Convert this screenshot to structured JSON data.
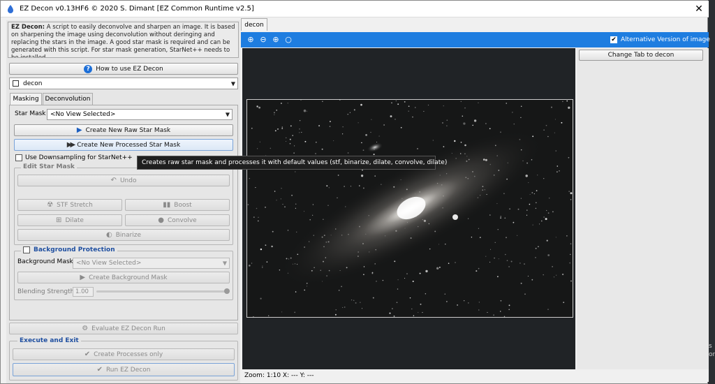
{
  "window": {
    "title": "EZ Decon v0.13HF6 © 2020 S. Dimant [EZ Common Runtime v2.5]",
    "close": "✕"
  },
  "description": {
    "lead": "EZ Decon:",
    "text": " A script to easily deconvolve and sharpen an image. It is based on sharpening the image using deconvolution without deringing and replacing the stars in the image. A good star mask is required and can be generated with this script. For star mask generation, StarNet++ needs to be installed."
  },
  "how_to_button": "How to use EZ Decon",
  "image_select": {
    "value": "decon"
  },
  "tabs": [
    {
      "label": "Masking",
      "active": true
    },
    {
      "label": "Deconvolution",
      "active": false
    }
  ],
  "masking": {
    "star_mask_label": "Star Mask",
    "star_mask_value": "<No View Selected>",
    "create_raw_button": "Create New Raw Star Mask",
    "create_processed_button": "Create New Processed Star Mask",
    "downsampling_label": "Use Downsampling for StarNet++",
    "edit_star_mask": {
      "title": "Edit Star Mask",
      "undo": "Undo",
      "stf_stretch": "STF Stretch",
      "boost": "Boost",
      "dilate": "Dilate",
      "convolve": "Convolve",
      "binarize": "Binarize"
    },
    "background_protection": {
      "title": "Background Protection",
      "mask_label": "Background Mask",
      "mask_value": "<No View Selected>",
      "create_button": "Create Background Mask",
      "blending_label": "Blending Strength",
      "blending_value": "1.00"
    }
  },
  "evaluate_button": "Evaluate EZ Decon Run",
  "execute": {
    "title": "Execute and Exit",
    "create_processes": "Create Processes only",
    "run": "Run EZ Decon"
  },
  "tooltip": "Creates raw star mask and processes it with default values (stf, binarize, dilate, convolve, dilate)",
  "view": {
    "tab_label": "decon",
    "alt_version_label": "Alternative Version of image",
    "alt_version_checked": true,
    "change_tab_button": "Change Tab to decon",
    "status": "Zoom: 1:10   X: ---   Y: ---"
  },
  "desktop_text": "s\nor",
  "colors": {
    "toolbar_blue": "#1e7de0",
    "group_title_blue": "#1f4fa0"
  }
}
